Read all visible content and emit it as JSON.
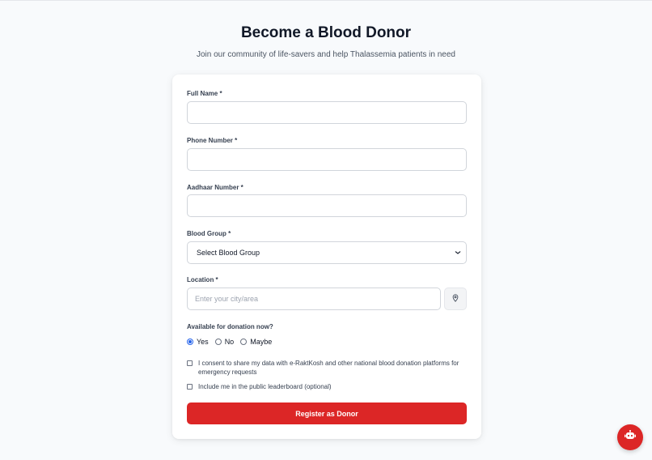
{
  "header": {
    "title": "Become a Blood Donor",
    "subtitle": "Join our community of life-savers and help Thalassemia patients in need"
  },
  "form": {
    "full_name": {
      "label": "Full Name *",
      "value": ""
    },
    "phone": {
      "label": "Phone Number *",
      "value": ""
    },
    "aadhaar": {
      "label": "Aadhaar Number *",
      "value": ""
    },
    "blood_group": {
      "label": "Blood Group *",
      "selected": "Select Blood Group"
    },
    "location": {
      "label": "Location *",
      "placeholder": "Enter your city/area",
      "value": ""
    },
    "availability": {
      "label": "Available for donation now?",
      "options": [
        "Yes",
        "No",
        "Maybe"
      ],
      "selected": "Yes"
    },
    "consent_text": "I consent to share my data with e-RaktKosh and other national blood donation platforms for emergency requests",
    "leaderboard_text": "Include me in the public leaderboard (optional)",
    "submit_label": "Register as Donor"
  },
  "colors": {
    "accent": "#dc2626",
    "radio": "#2563eb"
  },
  "icons": {
    "location": "map-pin-icon",
    "chatbot": "robot-icon",
    "select": "chevron-down-icon"
  }
}
